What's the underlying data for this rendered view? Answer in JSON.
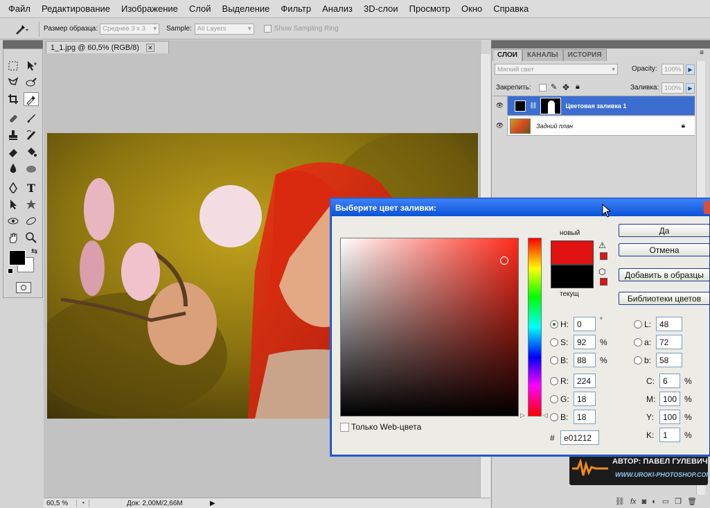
{
  "menu": [
    "Файл",
    "Редактирование",
    "Изображение",
    "Слой",
    "Выделение",
    "Фильтр",
    "Анализ",
    "3D-слои",
    "Просмотр",
    "Окно",
    "Справка"
  ],
  "options": {
    "sample_size_label": "Размер образца:",
    "sample_size_value": "Среднее 3 х 3",
    "sample_label": "Sample:",
    "sample_value": "All Layers",
    "show_ring": "Show Sampling Ring"
  },
  "document": {
    "tab_title": "1_1.jpg @ 60,5% (RGB/8)",
    "zoom": "60,5 %",
    "doc_info": "Док: 2,00M/2,66M"
  },
  "layers_panel": {
    "tabs": [
      "СЛОИ",
      "КАНАЛЫ",
      "ИСТОРИЯ"
    ],
    "blend_mode": "Мягкий свет",
    "opacity_label": "Opacity:",
    "opacity_value": "100%",
    "lock_label": "Закрепить:",
    "fill_label": "Заливка:",
    "fill_value": "100%",
    "layers": [
      {
        "name": "Цветовая заливка 1",
        "selected": true
      },
      {
        "name": "Задний план",
        "selected": false
      }
    ]
  },
  "color_picker": {
    "title": "Выберите цвет заливки:",
    "new_label": "новый",
    "current_label": "текущ",
    "new_color": "#e01212",
    "current_color": "#000000",
    "buttons": [
      "Да",
      "Отмена",
      "Добавить в образцы",
      "Библиотеки цветов"
    ],
    "web_only": "Только Web-цвета",
    "fields_left": [
      {
        "label": "H:",
        "value": "0",
        "unit": "°",
        "selected": true
      },
      {
        "label": "S:",
        "value": "92",
        "unit": "%",
        "selected": false
      },
      {
        "label": "B:",
        "value": "88",
        "unit": "%",
        "selected": false
      },
      {
        "label": "R:",
        "value": "224",
        "unit": "",
        "selected": false
      },
      {
        "label": "G:",
        "value": "18",
        "unit": "",
        "selected": false
      },
      {
        "label": "B:",
        "value": "18",
        "unit": "",
        "selected": false
      }
    ],
    "fields_lab": [
      {
        "label": "L:",
        "value": "48"
      },
      {
        "label": "a:",
        "value": "72"
      },
      {
        "label": "b:",
        "value": "58"
      }
    ],
    "fields_cmyk": [
      {
        "label": "C:",
        "value": "6",
        "unit": "%"
      },
      {
        "label": "M:",
        "value": "100",
        "unit": "%"
      },
      {
        "label": "Y:",
        "value": "100",
        "unit": "%"
      },
      {
        "label": "K:",
        "value": "1",
        "unit": "%"
      }
    ],
    "hex_label": "#",
    "hex_value": "e01212"
  },
  "watermark": {
    "author": "АВТОР: ПАВЕЛ ГУЛЕВИЧ",
    "site": "WWW.UROKI-PHOTOSHOP.COM"
  }
}
